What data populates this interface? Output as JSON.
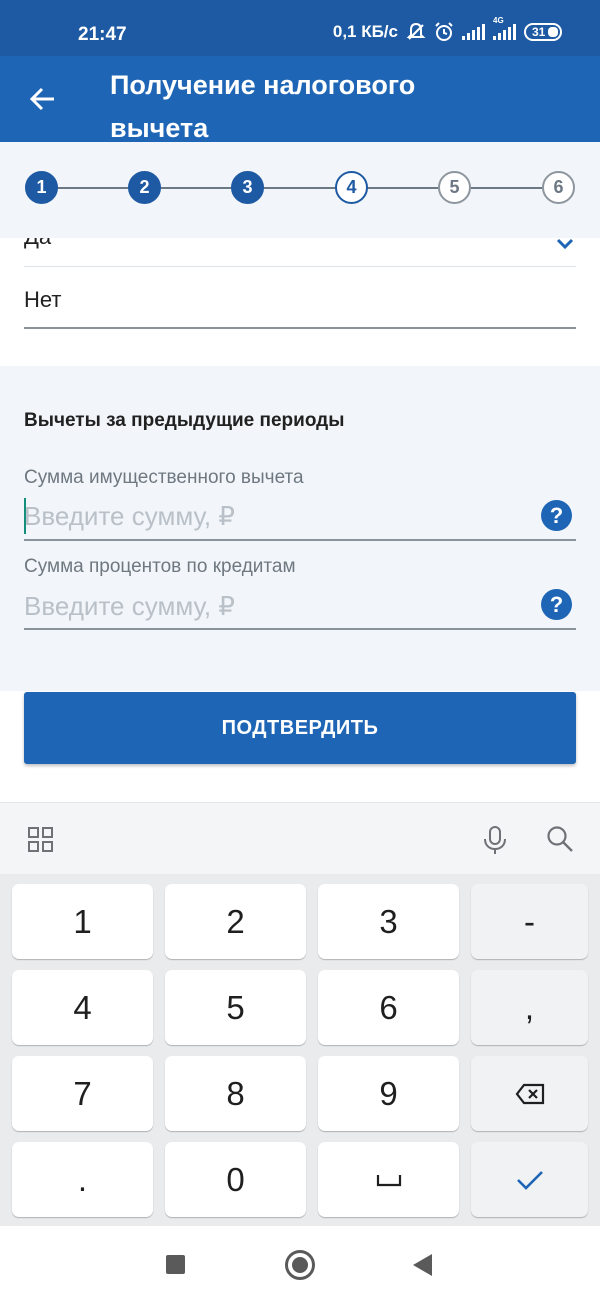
{
  "status_bar": {
    "time": "21:47",
    "network_speed": "0,1 КБ/с",
    "network_type": "4G",
    "battery": "31",
    "icons": [
      "notifications-off-icon",
      "alarm-icon",
      "signal-icon",
      "signal-4g-icon",
      "battery-icon"
    ]
  },
  "header": {
    "title": "Получение налогового вычета",
    "back_icon": "arrow-left-icon",
    "background": "#1e65b6"
  },
  "stepper": {
    "steps": [
      {
        "label": "1",
        "state": "done"
      },
      {
        "label": "2",
        "state": "done"
      },
      {
        "label": "3",
        "state": "done"
      },
      {
        "label": "4",
        "state": "current"
      },
      {
        "label": "5",
        "state": "todo"
      },
      {
        "label": "6",
        "state": "todo"
      }
    ]
  },
  "select": {
    "options": [
      "Да",
      "Нет"
    ],
    "chevron_icon": "chevron-down-icon"
  },
  "previous_periods": {
    "title": "Вычеты за предыдущие периоды",
    "fields": [
      {
        "label": "Сумма имущественного вычета",
        "value": "",
        "placeholder": "Введите сумму, ₽",
        "help_label": "?"
      },
      {
        "label": "Сумма процентов по кредитам",
        "value": "",
        "placeholder": "Введите сумму, ₽",
        "help_label": "?"
      }
    ]
  },
  "confirm": {
    "label": "ПОДТВЕРДИТЬ"
  },
  "keyboard": {
    "toolbar_icons": [
      "apps-grid-icon",
      "microphone-icon",
      "search-icon"
    ],
    "rows": [
      [
        "1",
        "2",
        "3",
        "-"
      ],
      [
        "4",
        "5",
        "6",
        ","
      ],
      [
        "7",
        "8",
        "9",
        "⌫"
      ],
      [
        ".",
        "0",
        "␣",
        "✓"
      ]
    ]
  },
  "nav_bar": {
    "icons": [
      "recent-apps-icon",
      "home-icon",
      "back-icon"
    ]
  },
  "colors": {
    "primary": "#1e65b6",
    "status_bar": "#1e5aa3",
    "panel": "#f2f6fa",
    "cursor": "#148f7b",
    "check": "#1e65b6"
  }
}
